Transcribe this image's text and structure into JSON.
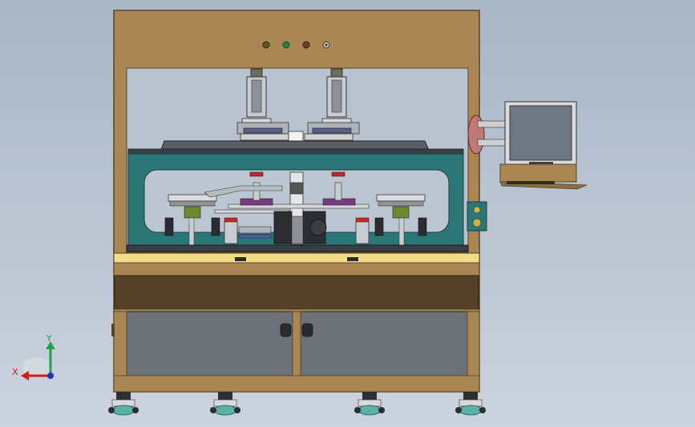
{
  "view": {
    "background": "#b4bfcd"
  },
  "triad": {
    "x_label": "X",
    "y_label": "Y",
    "x_color": "#d11c1c",
    "y_color": "#1fa34a",
    "z_color": "#2233cc"
  },
  "colors": {
    "frame": "#a98652",
    "frame_edge": "#5a4326",
    "panel_teal": "#2b7777",
    "drawer_dark": "#55412a",
    "cabinet_glass": "#6d7178",
    "light_bar": "#f2dc86",
    "monitor_screen": "#6f7882",
    "indicator_light_1": "#5c5a1a",
    "indicator_light_2": "#1c8a3c",
    "indicator_light_3": "#7a3b22"
  },
  "icons": {
    "triad": "coordinate-triad-icon",
    "casters": "caster-wheel-icon"
  }
}
